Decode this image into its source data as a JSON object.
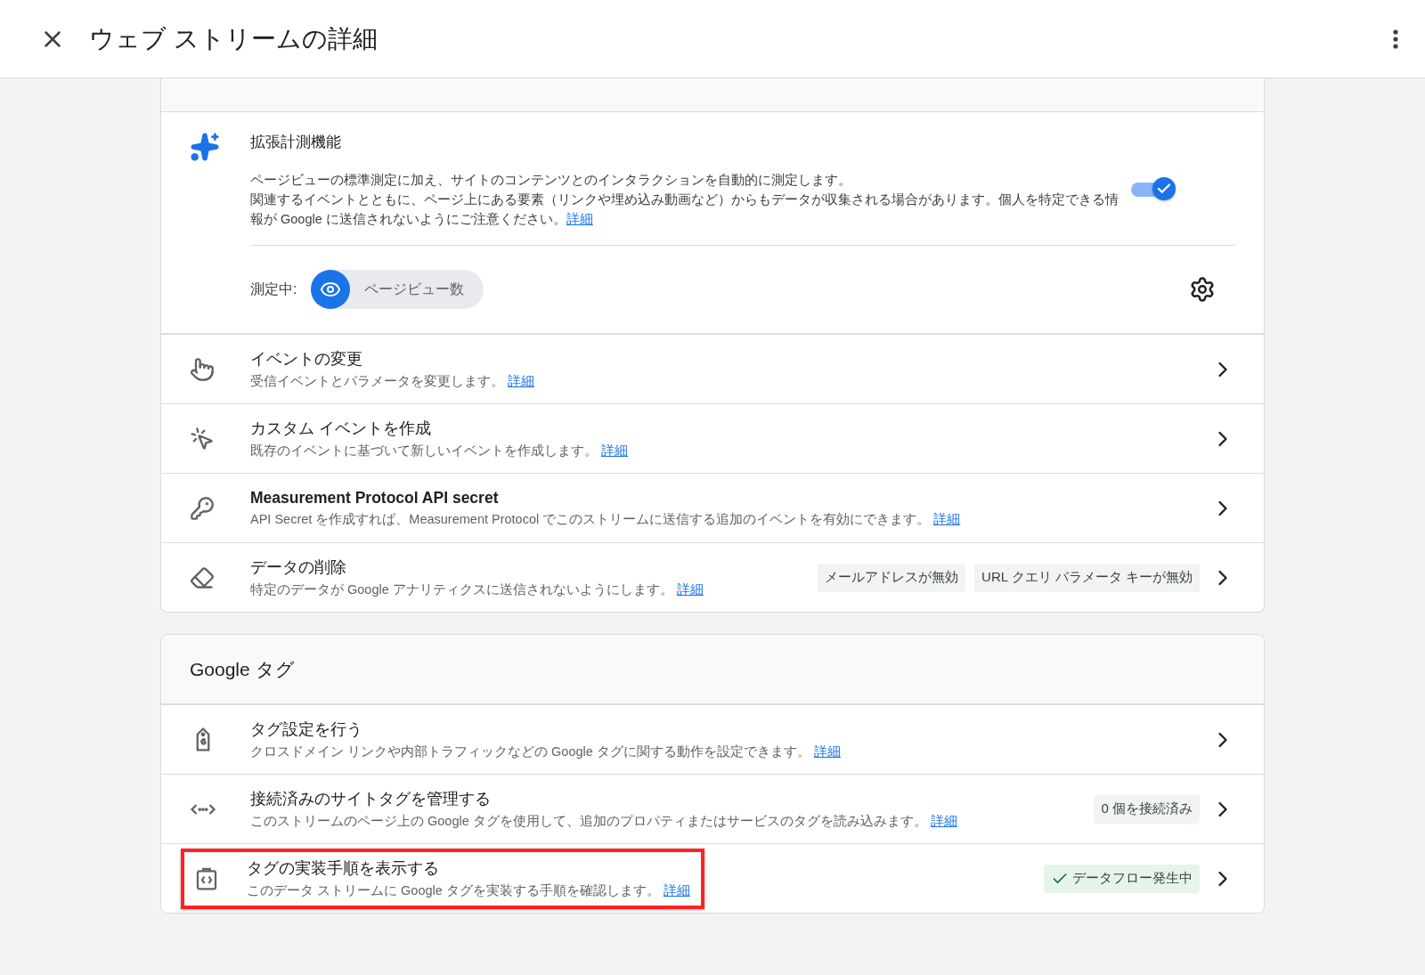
{
  "app_bar": {
    "title": "ウェブ ストリームの詳細"
  },
  "events_card": {
    "enhanced": {
      "title": "拡張計測機能",
      "lines": [
        "ページビューの標準測定に加え、サイトのコンテンツとのインタラクションを自動的に測定します。",
        "関連するイベントとともに、ページ上にある要素（リンクや埋め込み動画など）からもデータが収集される場合があります。個人を特定できる情報が Google に送信されないようにご注意ください。"
      ],
      "link": "詳細",
      "on": true,
      "measuring_label": "測定中:",
      "measuring": [
        {
          "label": "ページビュー数"
        }
      ]
    },
    "rows": [
      {
        "title": "イベントの変更",
        "bold": false,
        "description": "受信イベントとパラメータを変更します。",
        "link": "詳細",
        "chips": [],
        "highlighted": false
      },
      {
        "title": "カスタム イベントを作成",
        "bold": false,
        "description": "既存のイベントに基づいて新しいイベントを作成します。",
        "link": "詳細",
        "chips": [],
        "highlighted": false
      },
      {
        "title": "Measurement Protocol API secret",
        "bold": true,
        "description": "API Secret を作成すれば、Measurement Protocol でこのストリームに送信する追加のイベントを有効にできます。",
        "link": "詳細",
        "chips": [],
        "highlighted": false
      },
      {
        "title": "データの削除",
        "bold": false,
        "description": "特定のデータが Google アナリティクスに送信されないようにします。",
        "link": "詳細",
        "chips": [
          {
            "kind": "plain",
            "label": "メールアドレスが無効"
          },
          {
            "kind": "plain",
            "label": "URL クエリ パラメータ キーが無効"
          }
        ],
        "highlighted": false
      }
    ]
  },
  "google_tag_card": {
    "title": "Google タグ",
    "rows": [
      {
        "title": "タグ設定を行う",
        "bold": false,
        "description": "クロスドメイン リンクや内部トラフィックなどの Google タグに関する動作を設定できます。",
        "link": "詳細",
        "chips": [],
        "highlighted": false
      },
      {
        "title": "接続済みのサイトタグを管理する",
        "bold": false,
        "description": "このストリームのページ上の Google タグを使用して、追加のプロパティまたはサービスのタグを読み込みます。",
        "link": "詳細",
        "chips": [
          {
            "kind": "plain",
            "label": "0 個を接続済み"
          }
        ],
        "highlighted": false
      },
      {
        "title": "タグの実装手順を表示する",
        "bold": false,
        "description": "このデータ ストリームに Google タグを実装する手順を確認します。",
        "link": "詳細",
        "chips": [
          {
            "kind": "success",
            "label": "データフロー発生中"
          }
        ],
        "highlighted": true
      }
    ]
  }
}
